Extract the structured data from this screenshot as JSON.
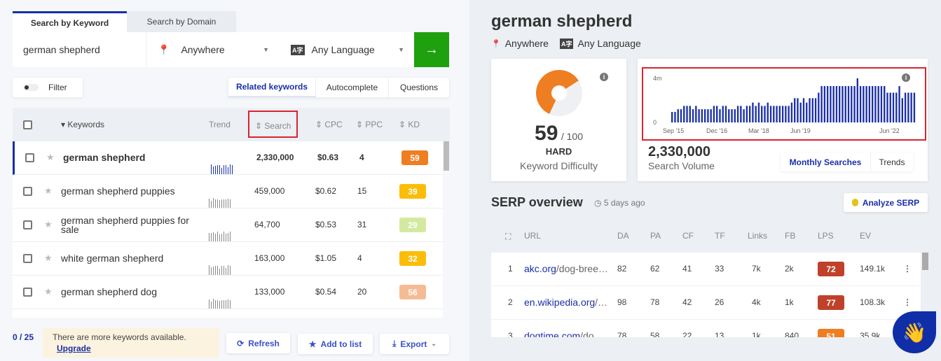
{
  "search": {
    "tabs": [
      "Search by Keyword",
      "Search by Domain"
    ],
    "query": "german shepherd",
    "location": "Anywhere",
    "language": "Any Language"
  },
  "filter_label": "Filter",
  "mode_tabs": [
    "Related keywords",
    "Autocomplete",
    "Questions"
  ],
  "table": {
    "headers": [
      "Keywords",
      "Trend",
      "Search",
      "CPC",
      "PPC",
      "KD"
    ],
    "rows": [
      {
        "keyword": "german shepherd",
        "search": "2,330,000",
        "cpc": "$0.63",
        "ppc": "4",
        "kd": "59",
        "kd_color": "#ef7d22"
      },
      {
        "keyword": "german shepherd puppies",
        "search": "459,000",
        "cpc": "$0.62",
        "ppc": "15",
        "kd": "39",
        "kd_color": "#fbbd08"
      },
      {
        "keyword": "german shepherd puppies for sale",
        "search": "64,700",
        "cpc": "$0.53",
        "ppc": "31",
        "kd": "29",
        "kd_color": "#d4e9a0"
      },
      {
        "keyword": "white german shepherd",
        "search": "163,000",
        "cpc": "$1.05",
        "ppc": "4",
        "kd": "32",
        "kd_color": "#fbbd08"
      },
      {
        "keyword": "german shepherd dog",
        "search": "133,000",
        "cpc": "$0.54",
        "ppc": "20",
        "kd": "56",
        "kd_color": "#f5bb95"
      }
    ]
  },
  "footer": {
    "count": "0 / 25",
    "notice": "There are more keywords available.",
    "upgrade": "Upgrade",
    "refresh": "Refresh",
    "add_to_list": "Add to list",
    "export": "Export"
  },
  "detail": {
    "title": "german shepherd",
    "location": "Anywhere",
    "language": "Any Language",
    "kd": {
      "value": "59",
      "max": "/ 100",
      "label": "HARD",
      "caption": "Keyword Difficulty",
      "fraction": 0.59
    },
    "volume": {
      "value": "2,330,000",
      "caption": "Search Volume",
      "tabs": [
        "Monthly Searches",
        "Trends"
      ]
    }
  },
  "chart_data": {
    "type": "bar",
    "ylim": [
      0,
      4000000
    ],
    "ytick_labels": [
      "0",
      "4m"
    ],
    "xtick_labels": [
      "Sep '15",
      "Dec '16",
      "Mar '18",
      "Jun '19",
      "Jun '22"
    ],
    "color": "#1a2fa8",
    "values_millions": [
      0.95,
      0.95,
      1.2,
      1.2,
      1.5,
      1.5,
      1.5,
      1.2,
      1.5,
      1.2,
      1.2,
      1.2,
      1.2,
      1.2,
      1.5,
      1.5,
      1.2,
      1.5,
      1.5,
      1.2,
      1.2,
      1.2,
      1.5,
      1.5,
      1.2,
      1.5,
      1.5,
      1.8,
      1.5,
      1.8,
      1.5,
      1.5,
      1.8,
      1.5,
      1.5,
      1.5,
      1.5,
      1.5,
      1.5,
      1.5,
      1.8,
      2.2,
      2.2,
      1.8,
      2.2,
      1.8,
      2.2,
      2.2,
      2.2,
      2.7,
      3.3,
      3.3,
      3.3,
      3.3,
      3.3,
      3.3,
      3.3,
      3.3,
      3.3,
      3.3,
      3.3,
      3.3,
      4.0,
      3.3,
      3.3,
      3.3,
      3.3,
      3.3,
      3.3,
      3.3,
      3.3,
      3.3,
      2.7,
      2.7,
      2.7,
      2.7,
      3.3,
      2.2,
      2.7,
      2.7,
      2.7,
      2.7
    ]
  },
  "serp": {
    "title": "SERP overview",
    "updated": "5 days ago",
    "analyze": "Analyze SERP",
    "headers": [
      "URL",
      "DA",
      "PA",
      "CF",
      "TF",
      "Links",
      "FB",
      "LPS",
      "EV"
    ],
    "rows": [
      {
        "n": "1",
        "domain": "akc.org",
        "path": "/dog-bree…",
        "da": "82",
        "pa": "62",
        "cf": "41",
        "tf": "33",
        "links": "7k",
        "fb": "2k",
        "lps": "72",
        "lps_color": "#c0412b",
        "ev": "149.1k"
      },
      {
        "n": "2",
        "domain": "en.wikipedia.org",
        "path": "/…",
        "da": "98",
        "pa": "78",
        "cf": "42",
        "tf": "26",
        "links": "4k",
        "fb": "1k",
        "lps": "77",
        "lps_color": "#c0412b",
        "ev": "108.3k"
      },
      {
        "n": "3",
        "domain": "dogtime.com",
        "path": "/do…",
        "da": "78",
        "pa": "58",
        "cf": "22",
        "tf": "13",
        "links": "1k",
        "fb": "840",
        "lps": "51",
        "lps_color": "#ef7d22",
        "ev": "35.9k"
      }
    ]
  }
}
